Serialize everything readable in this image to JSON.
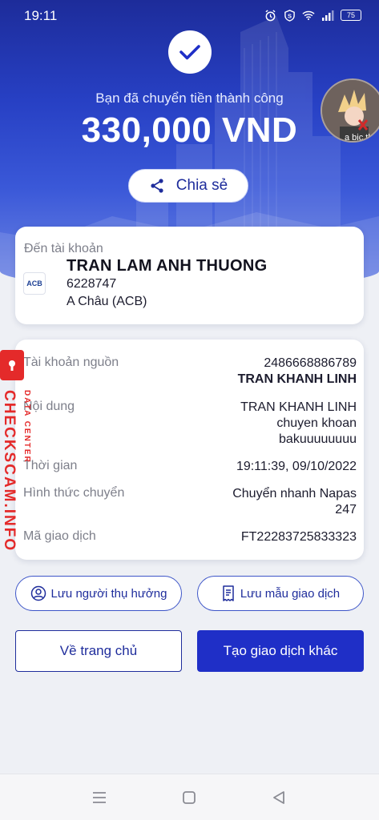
{
  "status_bar": {
    "time": "19:11",
    "battery": "75"
  },
  "hero": {
    "success_message": "Bạn đã chuyển tiền thành công",
    "amount": "330,000 VND",
    "share_label": "Chia sẻ",
    "avatar_caption": "a bic th"
  },
  "recipient": {
    "label": "Đến tài khoản",
    "bank_logo": "ACB",
    "name": "TRAN LAM ANH THUONG",
    "account_number": "6228747",
    "bank_name": "A Châu (ACB)"
  },
  "details": {
    "source_label": "Tài khoản nguồn",
    "source_account": "2486668886789",
    "source_name": "TRAN KHANH LINH",
    "content_label": "Nội dung",
    "content_line1": "TRAN KHANH LINH",
    "content_line2": "chuyen khoan",
    "content_line3": "bakuuuuuuuu",
    "time_label": "Thời gian",
    "time_value": "19:11:39, 09/10/2022",
    "method_label": "Hình thức chuyển",
    "method_line1": "Chuyển nhanh Napas",
    "method_line2": "247",
    "txid_label": "Mã giao dịch",
    "txid_value": "FT22283725833323"
  },
  "watermark": {
    "main": "CHECKSCAM.INFO",
    "sub": "DATA CENTER"
  },
  "actions": {
    "save_recipient": "Lưu người thụ hưởng",
    "save_template": "Lưu mẫu giao dịch",
    "home": "Về trang chủ",
    "new_transaction": "Tạo giao dịch khác"
  },
  "colors": {
    "primary": "#1f2fc7",
    "hero_top": "#1d2c9a",
    "watermark": "#e42a2a"
  },
  "icons": [
    "alarm-icon",
    "s-badge-icon",
    "wifi-icon",
    "signal-icon",
    "battery-icon",
    "check-icon",
    "share-icon",
    "person-circle-icon",
    "receipt-icon",
    "menu-icon",
    "square-icon",
    "back-triangle-icon"
  ]
}
